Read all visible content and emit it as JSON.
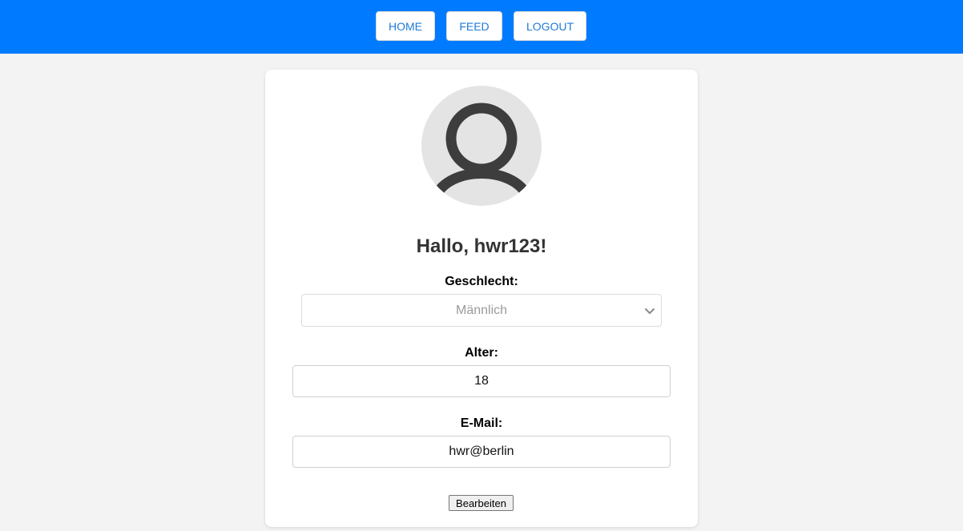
{
  "nav": {
    "home_label": "HOME",
    "feed_label": "FEED",
    "logout_label": "LOGOUT"
  },
  "profile": {
    "greeting": "Hallo, hwr123!",
    "gender_label": "Geschlecht:",
    "gender_value": "Männlich",
    "age_label": "Alter:",
    "age_value": "18",
    "email_label": "E-Mail:",
    "email_value": "hwr@berlin",
    "edit_button_label": "Bearbeiten",
    "avatar_icon": "user-icon"
  },
  "colors": {
    "topbar": "#007bff",
    "nav_text": "#1f7ad6",
    "page_background": "#f3f3f3",
    "card_background": "#ffffff",
    "avatar_background": "#e4e4e4",
    "avatar_stroke": "#3d3d3d"
  }
}
